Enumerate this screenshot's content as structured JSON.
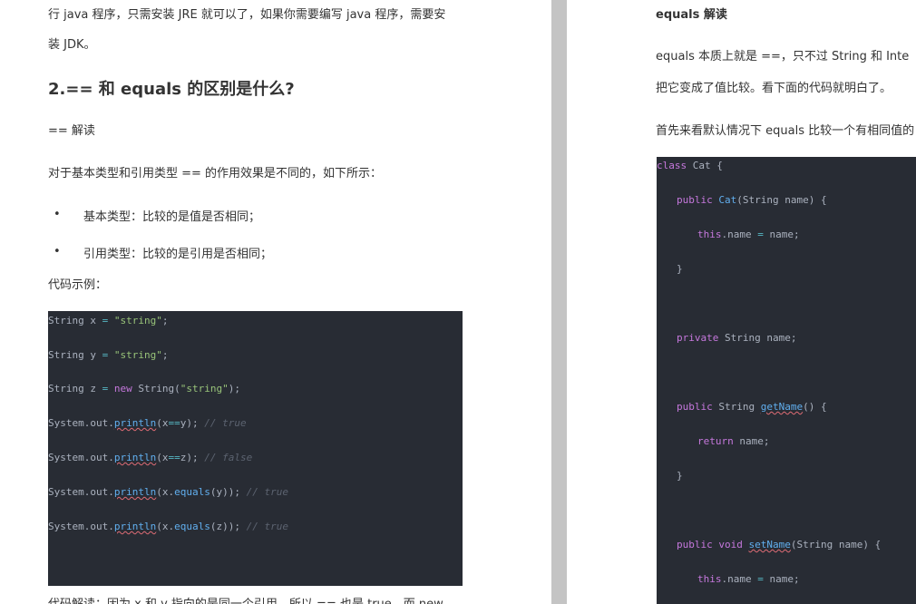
{
  "left": {
    "intro_line1": "行 java 程序，只需安装 JRE 就可以了，如果你需要编写 java 程序，需要安",
    "intro_line2": "装 JDK。",
    "heading": "2.== 和 equals 的区别是什么?",
    "subheading": "== 解读",
    "para1": "对于基本类型和引用类型 == 的作用效果是不同的，如下所示：",
    "bullets": [
      "基本类型：比较的是值是否相同；",
      "引用类型：比较的是引用是否相同；"
    ],
    "bullet_marker": "•",
    "code_label": "代码示例：",
    "code": {
      "l1": {
        "a": "String x ",
        "b": "=",
        "c": " ",
        "d": "\"string\"",
        "e": ";"
      },
      "l2": {
        "a": "String y ",
        "b": "=",
        "c": " ",
        "d": "\"string\"",
        "e": ";"
      },
      "l3": {
        "a": "String z ",
        "b": "=",
        "c": " ",
        "d": "new",
        "e": " String(",
        "f": "\"string\"",
        "g": ");"
      },
      "l4": {
        "a": "System.out.",
        "b": "println",
        "c": "(x",
        "d": "==",
        "e": "y); ",
        "f": "// true"
      },
      "l5": {
        "a": "System.out.",
        "b": "println",
        "c": "(x",
        "d": "==",
        "e": "z); ",
        "f": "// false"
      },
      "l6": {
        "a": "System.out.",
        "b": "println",
        "c": "(x.",
        "d": "equals",
        "e": "(y)); ",
        "f": "// true"
      },
      "l7": {
        "a": "System.out.",
        "b": "println",
        "c": "(x.",
        "d": "equals",
        "e": "(z)); ",
        "f": "// true"
      }
    },
    "bottom_line": "代码解读：因为 x 和 y 指向的是同一个引用，所以 == 也是 true，而 new"
  },
  "right": {
    "heading": "equals 解读",
    "para1_line1": "equals 本质上就是 ==，只不过 String 和 Inte",
    "para1_line2": "把它变成了值比较。看下面的代码就明白了。",
    "para2": "首先来看默认情况下 equals 比较一个有相同值的",
    "code": {
      "r1": {
        "a": "class",
        "b": " Cat {"
      },
      "r2": {
        "a": "public",
        "b": " ",
        "c": "Cat",
        "d": "(String name) {"
      },
      "r3": {
        "a": "this",
        "b": ".name ",
        "c": "=",
        "d": " name;"
      },
      "r4": {
        "a": "}"
      },
      "r5": {
        "a": "private",
        "b": " String name;"
      },
      "r6": {
        "a": "public",
        "b": " String ",
        "c": "getName",
        "d": "() {"
      },
      "r7": {
        "a": "return",
        "b": " name;"
      },
      "r8": {
        "a": "}"
      },
      "r9": {
        "a": "public",
        "b": " ",
        "c": "void",
        "d": " ",
        "e": "setName",
        "f": "(String name) {"
      },
      "r10": {
        "a": "this",
        "b": ".name ",
        "c": "=",
        "d": " name;"
      }
    }
  },
  "colors": {
    "code_bg": "#282c34",
    "keyword": "#c678dd",
    "string": "#98c379",
    "function": "#61afef",
    "comment": "#5c6370",
    "gutter": "#c4c4c4"
  }
}
